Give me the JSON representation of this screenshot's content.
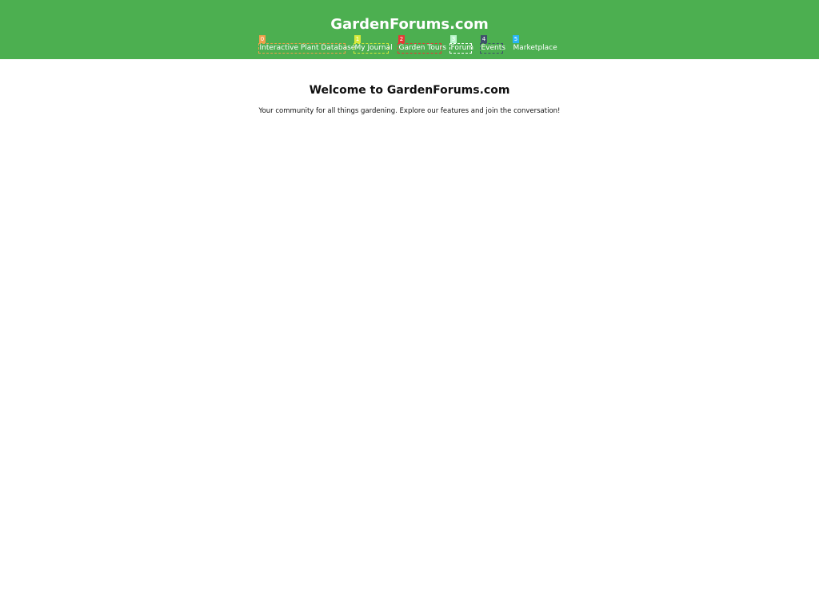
{
  "header": {
    "title": "GardenForums.com",
    "nav": [
      {
        "badge": "0",
        "label": "Interactive Plant Database",
        "badge_color": "#f0a04b",
        "outline_color": "#f0a04b"
      },
      {
        "badge": "1",
        "label": "My Journal",
        "badge_color": "#d7e93b",
        "outline_color": "#d7e93b"
      },
      {
        "badge": "2",
        "label": "Garden Tours",
        "badge_color": "#e53935",
        "outline_color": "#e53935"
      },
      {
        "badge": "3",
        "label": "Forum",
        "badge_color": "#b9f6ca",
        "outline_color": "#ffffff"
      },
      {
        "badge": "4",
        "label": "Events",
        "badge_color": "#3f4f6b",
        "outline_color": "#3f4f6b"
      },
      {
        "badge": "5",
        "label": "Marketplace",
        "badge_color": "#29b6f6",
        "outline_color": ""
      }
    ]
  },
  "main": {
    "heading": "Welcome to GardenForums.com",
    "tagline": "Your community for all things gardening. Explore our features and join the conversation!"
  },
  "theme": {
    "header_bg": "#4caf50",
    "header_text": "#ffffff",
    "body_bg": "#ffffff"
  }
}
